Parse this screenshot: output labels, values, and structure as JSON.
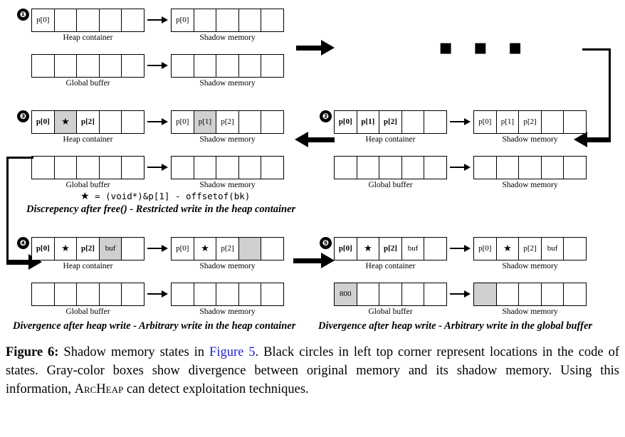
{
  "figure": {
    "label": "Figure 6:",
    "caption_part1": " Shadow memory states in ",
    "caption_xref": "Figure 5",
    "caption_part2": ". Black circles in left top corner represent locations in the code of states. Gray-color boxes show divergence between original memory and its shadow memory. Using this information, ",
    "caption_tool": "ArcHeap",
    "caption_part3": " can detect exploitation techniques."
  },
  "labels": {
    "heap_container": "Heap container",
    "global_buffer": "Global buffer",
    "shadow_memory": "Shadow memory"
  },
  "glyphs": {
    "star": "★",
    "ellipsis": "▪ ▪ ▪"
  },
  "colors": {
    "divergence_gray": "#d0d0d0",
    "xref_blue": "#2222cc",
    "ink": "#000000"
  },
  "panels": [
    {
      "id": "state-1",
      "marker": "❶",
      "heap": [
        "p[0]",
        "",
        "",
        "",
        ""
      ],
      "heap_gray": [
        false,
        false,
        false,
        false,
        false
      ],
      "heap_shadow": [
        "p[0]",
        "",
        "",
        "",
        ""
      ],
      "heap_shadow_gray": [
        false,
        false,
        false,
        false,
        false
      ],
      "global": [
        "",
        "",
        "",
        "",
        ""
      ],
      "global_gray": [
        false,
        false,
        false,
        false,
        false
      ],
      "global_shadow": [
        "",
        "",
        "",
        "",
        ""
      ],
      "global_shadow_gray": [
        false,
        false,
        false,
        false,
        false
      ],
      "bold_heap": false
    },
    {
      "id": "state-2",
      "marker": "❷",
      "heap": [
        "p[0]",
        "p[1]",
        "p[2]",
        "",
        ""
      ],
      "heap_gray": [
        false,
        false,
        false,
        false,
        false
      ],
      "heap_shadow": [
        "p[0]",
        "p[1]",
        "p[2]",
        "",
        ""
      ],
      "heap_shadow_gray": [
        false,
        false,
        false,
        false,
        false
      ],
      "global": [
        "",
        "",
        "",
        "",
        ""
      ],
      "global_gray": [
        false,
        false,
        false,
        false,
        false
      ],
      "global_shadow": [
        "",
        "",
        "",
        "",
        ""
      ],
      "global_shadow_gray": [
        false,
        false,
        false,
        false,
        false
      ],
      "bold_heap": true
    },
    {
      "id": "state-3",
      "marker": "❸",
      "heap": [
        "p[0]",
        "★",
        "p[2]",
        "",
        ""
      ],
      "heap_gray": [
        false,
        true,
        false,
        false,
        false
      ],
      "heap_shadow": [
        "p[0]",
        "p[1]",
        "p[2]",
        "",
        ""
      ],
      "heap_shadow_gray": [
        false,
        true,
        false,
        false,
        false
      ],
      "global": [
        "",
        "",
        "",
        "",
        ""
      ],
      "global_gray": [
        false,
        false,
        false,
        false,
        false
      ],
      "global_shadow": [
        "",
        "",
        "",
        "",
        ""
      ],
      "global_shadow_gray": [
        false,
        false,
        false,
        false,
        false
      ],
      "bold_heap": true,
      "formula_prefix": "★",
      "formula_rest": " = (void*)&p[1] - offsetof(bk)",
      "subcaption": "Discrepency after free() - Restricted write in the heap container"
    },
    {
      "id": "state-4",
      "marker": "❹",
      "heap": [
        "p[0]",
        "★",
        "p[2]",
        "buf",
        ""
      ],
      "heap_gray": [
        false,
        false,
        false,
        true,
        false
      ],
      "heap_shadow": [
        "p[0]",
        "★",
        "p[2]",
        "",
        ""
      ],
      "heap_shadow_gray": [
        false,
        false,
        false,
        true,
        false
      ],
      "global": [
        "",
        "",
        "",
        "",
        ""
      ],
      "global_gray": [
        false,
        false,
        false,
        false,
        false
      ],
      "global_shadow": [
        "",
        "",
        "",
        "",
        ""
      ],
      "global_shadow_gray": [
        false,
        false,
        false,
        false,
        false
      ],
      "bold_heap": true,
      "subcaption": "Divergence after heap write - Arbitrary write in the heap container"
    },
    {
      "id": "state-5",
      "marker": "❺",
      "heap": [
        "p[0]",
        "★",
        "p[2]",
        "buf",
        ""
      ],
      "heap_gray": [
        false,
        false,
        false,
        false,
        false
      ],
      "heap_shadow": [
        "p[0]",
        "★",
        "p[2]",
        "buf",
        ""
      ],
      "heap_shadow_gray": [
        false,
        false,
        false,
        false,
        false
      ],
      "global": [
        "800",
        "",
        "",
        "",
        ""
      ],
      "global_gray": [
        true,
        false,
        false,
        false,
        false
      ],
      "global_shadow": [
        "",
        "",
        "",
        "",
        ""
      ],
      "global_shadow_gray": [
        true,
        false,
        false,
        false,
        false
      ],
      "bold_heap": true,
      "subcaption": "Divergence after heap write - Arbitrary write in the global buffer"
    }
  ]
}
